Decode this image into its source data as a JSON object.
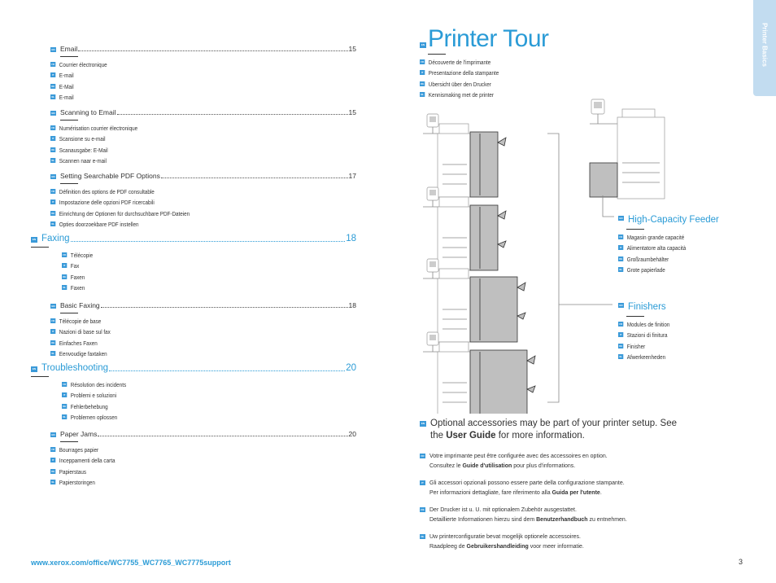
{
  "toc": [
    {
      "type": "sub",
      "label": "Email",
      "page": "15",
      "translations": [
        {
          "lang": "FR",
          "text": "Courrier électronique"
        },
        {
          "lang": "IT",
          "text": "E-mail"
        },
        {
          "lang": "DE",
          "text": "E-Mail"
        },
        {
          "lang": "NL",
          "text": "E-mail"
        }
      ]
    },
    {
      "type": "sub",
      "label": "Scanning to Email",
      "page": "15",
      "translations": [
        {
          "lang": "FR",
          "text": "Numérisation courrier électronique"
        },
        {
          "lang": "IT",
          "text": "Scansione su e-mail"
        },
        {
          "lang": "DE",
          "text": "Scanausgabe: E-Mail"
        },
        {
          "lang": "NL",
          "text": "Scannen naar e-mail"
        }
      ]
    },
    {
      "type": "sub",
      "label": "Setting Searchable PDF Options",
      "page": "17",
      "translations": [
        {
          "lang": "FR",
          "text": "Définition des options de PDF consultable"
        },
        {
          "lang": "IT",
          "text": "Impostazione delle opzioni PDF ricercabili"
        },
        {
          "lang": "DE",
          "text": "Einrichtung der Optionen für durchsuchbare PDF-Dateien"
        },
        {
          "lang": "NL",
          "text": "Opties doorzoekbare PDF instellen"
        }
      ]
    },
    {
      "type": "main",
      "label": "Faxing",
      "page": "18",
      "translations": [
        {
          "lang": "FR",
          "text": "Télécopie"
        },
        {
          "lang": "IT",
          "text": "Fax"
        },
        {
          "lang": "DE",
          "text": "Faxen"
        },
        {
          "lang": "NL",
          "text": "Faxen"
        }
      ]
    },
    {
      "type": "sub",
      "label": "Basic Faxing",
      "page": "18",
      "translations": [
        {
          "lang": "FR",
          "text": "Télécopie de base"
        },
        {
          "lang": "IT",
          "text": "Nazioni di base sul fax"
        },
        {
          "lang": "DE",
          "text": "Einfaches Faxen"
        },
        {
          "lang": "NL",
          "text": "Eenvoudige faxtaken"
        }
      ]
    },
    {
      "type": "main",
      "label": "Troubleshooting",
      "page": "20",
      "translations": [
        {
          "lang": "FR",
          "text": "Résolution des incidents"
        },
        {
          "lang": "IT",
          "text": "Problemi e soluzioni"
        },
        {
          "lang": "DE",
          "text": "Fehlerbehebung"
        },
        {
          "lang": "NL",
          "text": "Problemen oplossen"
        }
      ]
    },
    {
      "type": "sub",
      "label": "Paper Jams",
      "page": "20",
      "translations": [
        {
          "lang": "FR",
          "text": "Bourrages papier"
        },
        {
          "lang": "IT",
          "text": "Inceppamenti della carta"
        },
        {
          "lang": "DE",
          "text": "Papierstaus"
        },
        {
          "lang": "NL",
          "text": "Papierstoringen"
        }
      ]
    }
  ],
  "printer_tour": {
    "title": "Printer Tour",
    "lang": "EN",
    "translations": [
      {
        "lang": "FR",
        "text": "Découverte de l'imprimante"
      },
      {
        "lang": "IT",
        "text": "Presentazione della stampante"
      },
      {
        "lang": "DE",
        "text": "Übersicht über den Drucker"
      },
      {
        "lang": "NL",
        "text": "Kennismaking met de printer"
      }
    ]
  },
  "callouts": {
    "hcf": {
      "title": "High-Capacity Feeder",
      "translations": [
        {
          "lang": "FR",
          "text": "Magasin grande capacité"
        },
        {
          "lang": "IT",
          "text": "Alimentatore alta capacità"
        },
        {
          "lang": "DE",
          "text": "Großraumbehälter"
        },
        {
          "lang": "NL",
          "text": "Grote papierlade"
        }
      ]
    },
    "finishers": {
      "title": "Finishers",
      "translations": [
        {
          "lang": "FR",
          "text": "Modules de finition"
        },
        {
          "lang": "IT",
          "text": "Stazioni di finitura"
        },
        {
          "lang": "DE",
          "text": "Finisher"
        },
        {
          "lang": "NL",
          "text": "Afwerkeenheden"
        }
      ]
    }
  },
  "notes": {
    "en": {
      "lang": "EN",
      "pre": "Optional accessories may be part of your printer setup. See the ",
      "bold": "User Guide",
      "post": " for more information."
    },
    "items": [
      {
        "lang": "FR",
        "line1": "Votre imprimante peut être configurée avec des accessoires en option.",
        "pre": "Consultez le ",
        "bold": "Guide d'utilisation",
        "post": " pour plus d'informations."
      },
      {
        "lang": "IT",
        "line1": "Gli accessori opzionali possono essere parte della configurazione stampante.",
        "pre": "Per informazioni dettagliate, fare riferimento alla ",
        "bold": "Guida per l'utente",
        "post": "."
      },
      {
        "lang": "DE",
        "line1": "Der Drucker ist u. U. mit optionalem Zubehör ausgestattet.",
        "pre": "Detaillierte Informationen hierzu sind dem ",
        "bold": "Benutzerhandbuch",
        "post": " zu entnehmen."
      },
      {
        "lang": "NL",
        "line1": "Uw printerconfiguratie bevat mogelijk optionele accessoires.",
        "pre": "Raadpleeg de ",
        "bold": "Gebruikershandleiding",
        "post": " voor meer informatie."
      }
    ]
  },
  "side_tab": "Printer Basics",
  "footer": {
    "url": "www.xerox.com/office/WC7755_WC7765_WC7775support",
    "page": "3"
  },
  "colors": {
    "accent": "#2a9bd6",
    "tab": "#c2dcf0",
    "badge": "#3a9ad9"
  }
}
